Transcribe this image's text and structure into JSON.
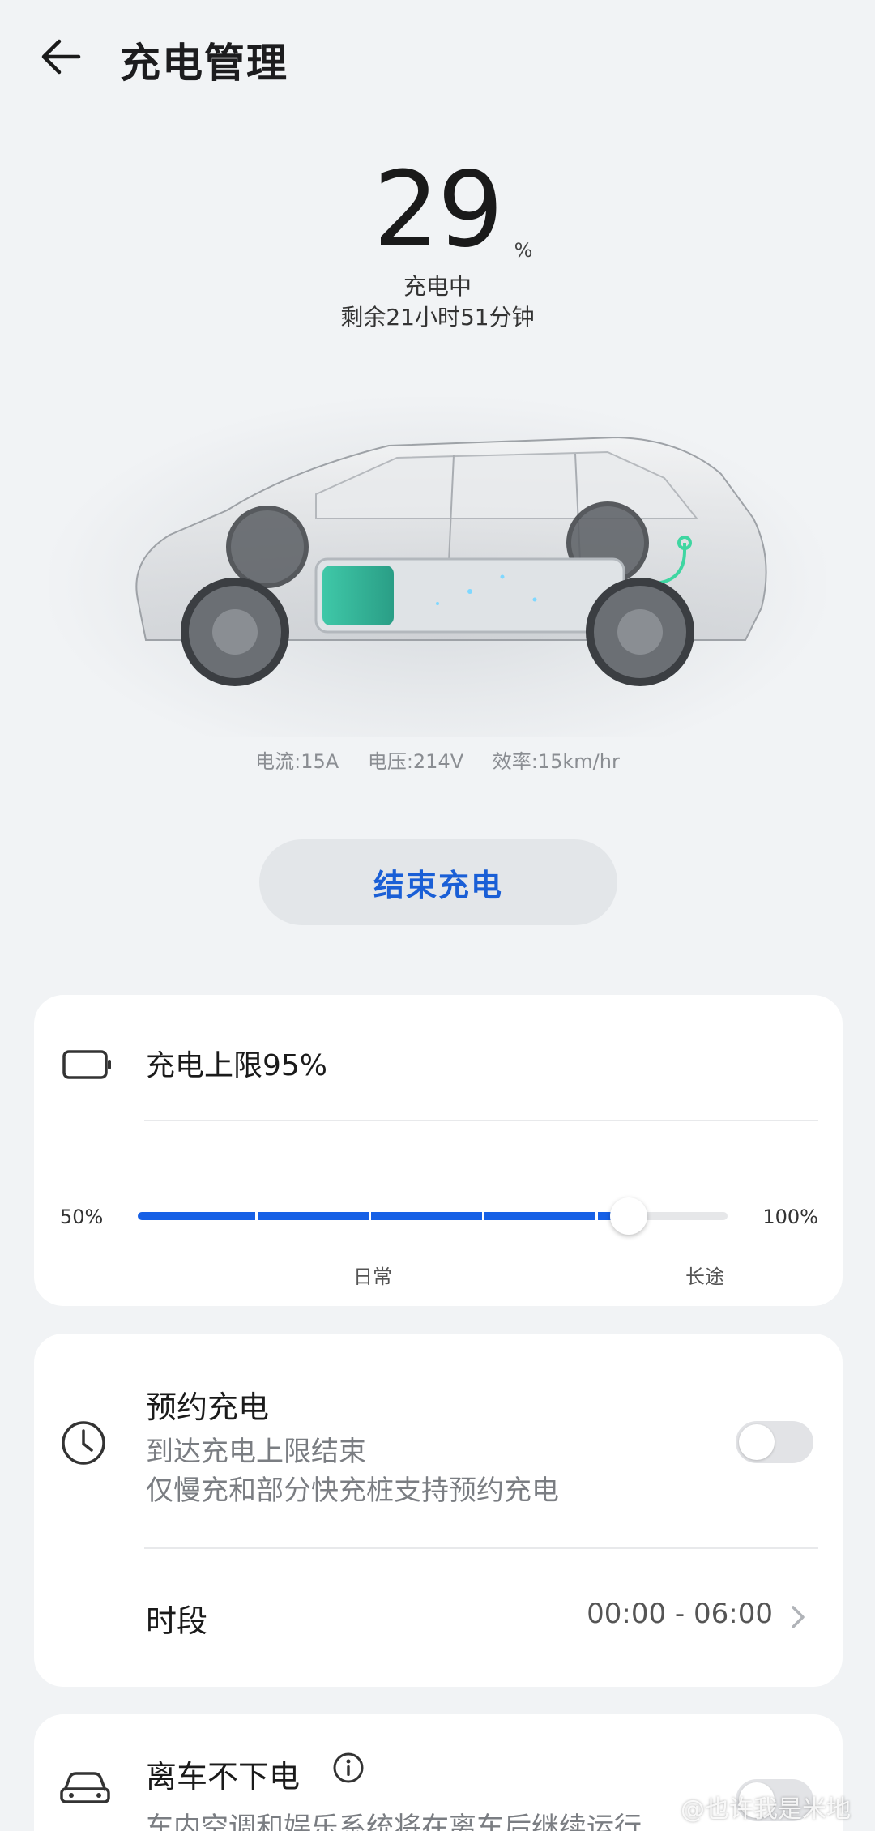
{
  "header": {
    "title": "充电管理",
    "back_icon": "arrow-left-icon"
  },
  "status": {
    "percent": "29",
    "unit": "%",
    "state": "充电中",
    "remaining": "剩余21小时51分钟"
  },
  "metrics": {
    "current": "电流:15A",
    "voltage": "电压:214V",
    "efficiency": "效率:15km/hr"
  },
  "end_button": {
    "label": "结束充电",
    "color": "#1a5fd6"
  },
  "charge_limit": {
    "icon": "battery-icon",
    "title": "充电上限95%",
    "slider": {
      "min_label": "50%",
      "max_label": "100%",
      "min": 50,
      "max": 100,
      "value": 95,
      "fill_color": "#1660e6"
    },
    "marks": {
      "daily": "日常",
      "long_trip": "长途"
    }
  },
  "schedule": {
    "icon": "clock-icon",
    "title": "预约充电",
    "sub1": "到达充电上限结束",
    "sub2": "仅慢充和部分快充桩支持预约充电",
    "enabled": false,
    "period_label": "时段",
    "period_value": "00:00 - 06:00"
  },
  "keep_power": {
    "icon": "car-icon",
    "title": "离车不下电",
    "info_icon": "info-icon",
    "sub": "车内空调和娱乐系统将在离车后继续运行",
    "enabled": false
  },
  "watermark": "@也许我是米地"
}
